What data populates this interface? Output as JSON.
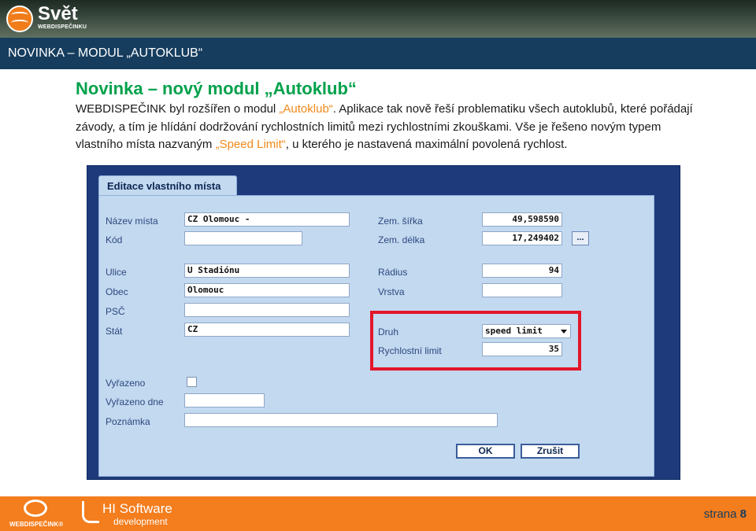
{
  "header": {
    "logo_title": "Svět",
    "logo_subtitle": "WEBDISPEČINKU"
  },
  "section_title": "NOVINKA – MODUL „AUTOKLUB“",
  "content": {
    "heading": "Novinka – nový modul „Autoklub“",
    "para": {
      "t1": "WEBDISPEČINK byl rozšířen o modul ",
      "h1": "„Autoklub“",
      "t2": ". Aplikace tak nově řeší problematiku všech autoklubů, které pořádají závody, a tím je hlídání dodržování rychlostních limitů mezi rychlostními zkouškami. Vše je řešeno novým typem vlastního místa nazvaným ",
      "h2": "„Speed Limit“",
      "t3": ", u kterého je nastavená maximální povolená rychlost."
    }
  },
  "form": {
    "tab_title": "Editace vlastního místa",
    "fields": {
      "nazev_label": "Název místa",
      "nazev_value": "CZ Olomouc -",
      "kod_label": "Kód",
      "kod_value": "",
      "ulice_label": "Ulice",
      "ulice_value": "U Stadiónu",
      "obec_label": "Obec",
      "obec_value": "Olomouc",
      "psc_label": "PSČ",
      "psc_value": "",
      "stat_label": "Stát",
      "stat_value": "CZ",
      "sirka_label": "Zem. šířka",
      "sirka_value": "49,598590",
      "delka_label": "Zem. délka",
      "delka_value": "17,249402",
      "delka_button": "...",
      "radius_label": "Rádius",
      "radius_value": "94",
      "vrstva_label": "Vrstva",
      "vrstva_value": "",
      "druh_label": "Druh",
      "druh_value": "speed limit",
      "limit_label": "Rychlostní limit",
      "limit_value": "35",
      "vyrazeno_label": "Vyřazeno",
      "vyrazeno_dne_label": "Vyřazeno dne",
      "vyrazeno_dne_value": "",
      "poznamka_label": "Poznámka",
      "poznamka_value": ""
    },
    "ok_label": "OK",
    "cancel_label": "Zrušit"
  },
  "footer": {
    "logo1_text": "WEBDISPEČINK®",
    "logo2_title": "HI Software",
    "logo2_sub": "development",
    "page_label": "strana ",
    "page_number": "8"
  },
  "colors": {
    "accent_green": "#00a14b",
    "accent_orange": "#f47d1d",
    "section_blue": "#163d5e",
    "highlight_red": "#e3162a"
  }
}
